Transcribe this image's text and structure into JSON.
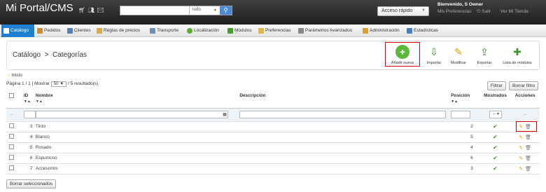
{
  "header": {
    "logo": "Mi Portal/CMS",
    "search": {
      "value": "",
      "scope": "todo"
    },
    "quick_access": "Acceso rápido",
    "welcome": "Bienvenido, S Owner",
    "links": [
      "Mis Preferencias",
      "Salir",
      "Ver Mi Tienda"
    ]
  },
  "nav": {
    "tabs": [
      "Catálogo",
      "Pedidos",
      "Clientes",
      "Reglas de precios",
      "Transporte",
      "Localización",
      "Módulos",
      "Preferencias",
      "Parámetros Avanzados",
      "Administración",
      "Estadísticas"
    ],
    "active": "Catálogo"
  },
  "page": {
    "breadcrumb_section": "Catálogo",
    "breadcrumb_sep": ">",
    "title": "Categorías",
    "toolbar": [
      "Añadir nueva",
      "Importar",
      "Modificar",
      "Exportar",
      "Lista de módulos"
    ]
  },
  "home_link": "Inicio",
  "pagination": {
    "text_a": "Página 1 / 1 | Mostrar",
    "per_page": "50",
    "text_b": "/ 5 resultado(s)"
  },
  "buttons": {
    "filter": "Filtrar",
    "reset": "Borrar filtro",
    "bulk_delete": "Borrar seleccionados"
  },
  "table": {
    "columns": {
      "id": "ID",
      "name": "Nombre",
      "description": "Descripción",
      "position": "Posición",
      "shown": "Mostrados",
      "actions": "Acciones"
    },
    "filter_shown_value": "--",
    "filter_actions": "--",
    "rows": [
      {
        "id": "3",
        "name": "Tinto",
        "description": "",
        "position": "2",
        "shown": true
      },
      {
        "id": "4",
        "name": "Blanco",
        "description": "",
        "position": "5",
        "shown": true
      },
      {
        "id": "5",
        "name": "Rosado",
        "description": "",
        "position": "4",
        "shown": true
      },
      {
        "id": "6",
        "name": "Espumoso",
        "description": "",
        "position": "6",
        "shown": true
      },
      {
        "id": "7",
        "name": "Accesorios",
        "description": "",
        "position": "3",
        "shown": true
      }
    ]
  },
  "colors": {
    "header_bg": "#2a2a2a",
    "active_tab": "#1f7fd1",
    "highlight": "#dd0000",
    "ok": "#3c9a2a"
  }
}
